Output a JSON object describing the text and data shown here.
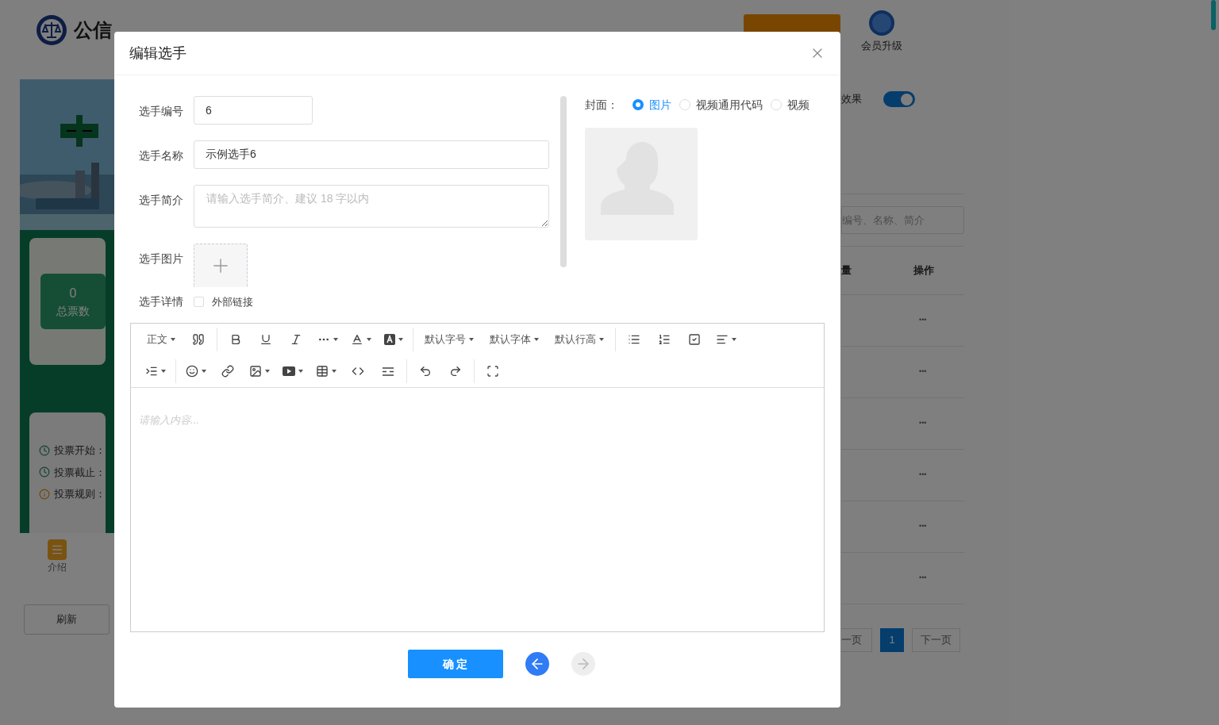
{
  "header": {
    "logo_text": "公信",
    "vip_label": "会员升级"
  },
  "left_panel": {
    "total_votes": {
      "value": "0",
      "label": "总票数"
    },
    "info": [
      {
        "kind": "clock",
        "label": "投票开始："
      },
      {
        "kind": "clock",
        "label": "投票截止："
      },
      {
        "kind": "info",
        "label": "投票规则："
      }
    ],
    "nav_label": "介绍",
    "refresh": "刷新"
  },
  "right_panel": {
    "effect_label": "效果",
    "effect_on": true,
    "search_placeholder": "编号、名称、简介",
    "columns": [
      "量",
      "操作"
    ],
    "row_actions": [
      "•••",
      "•••",
      "•••",
      "•••",
      "•••",
      "•••"
    ],
    "pagination": {
      "prev": "一页",
      "pages": [
        {
          "label": "1",
          "selected": true
        }
      ],
      "next": "下一页"
    }
  },
  "dialog": {
    "title": "编辑选手",
    "fields": [
      {
        "kind": "input",
        "label": "选手编号",
        "value": "6"
      },
      {
        "kind": "input-wide",
        "label": "选手名称",
        "value": "示例选手6"
      },
      {
        "kind": "textarea",
        "label": "选手简介",
        "placeholder": "请输入选手简介、建议 18 字以内"
      },
      {
        "kind": "upload",
        "label": "选手图片"
      }
    ],
    "detail": {
      "label": "选手详情",
      "checkbox_label": "外部链接",
      "checked": false
    },
    "cover": {
      "label": "封面：",
      "options": [
        {
          "label": "图片",
          "selected": true
        },
        {
          "label": "视频通用代码",
          "selected": false
        },
        {
          "label": "视频",
          "selected": false
        }
      ]
    },
    "editor": {
      "selects": [
        "正文",
        "默认字号",
        "默认字体",
        "默认行高"
      ],
      "placeholder": "请输入内容..."
    },
    "confirm": "确 定",
    "prev_disabled": false,
    "next_disabled": true
  }
}
